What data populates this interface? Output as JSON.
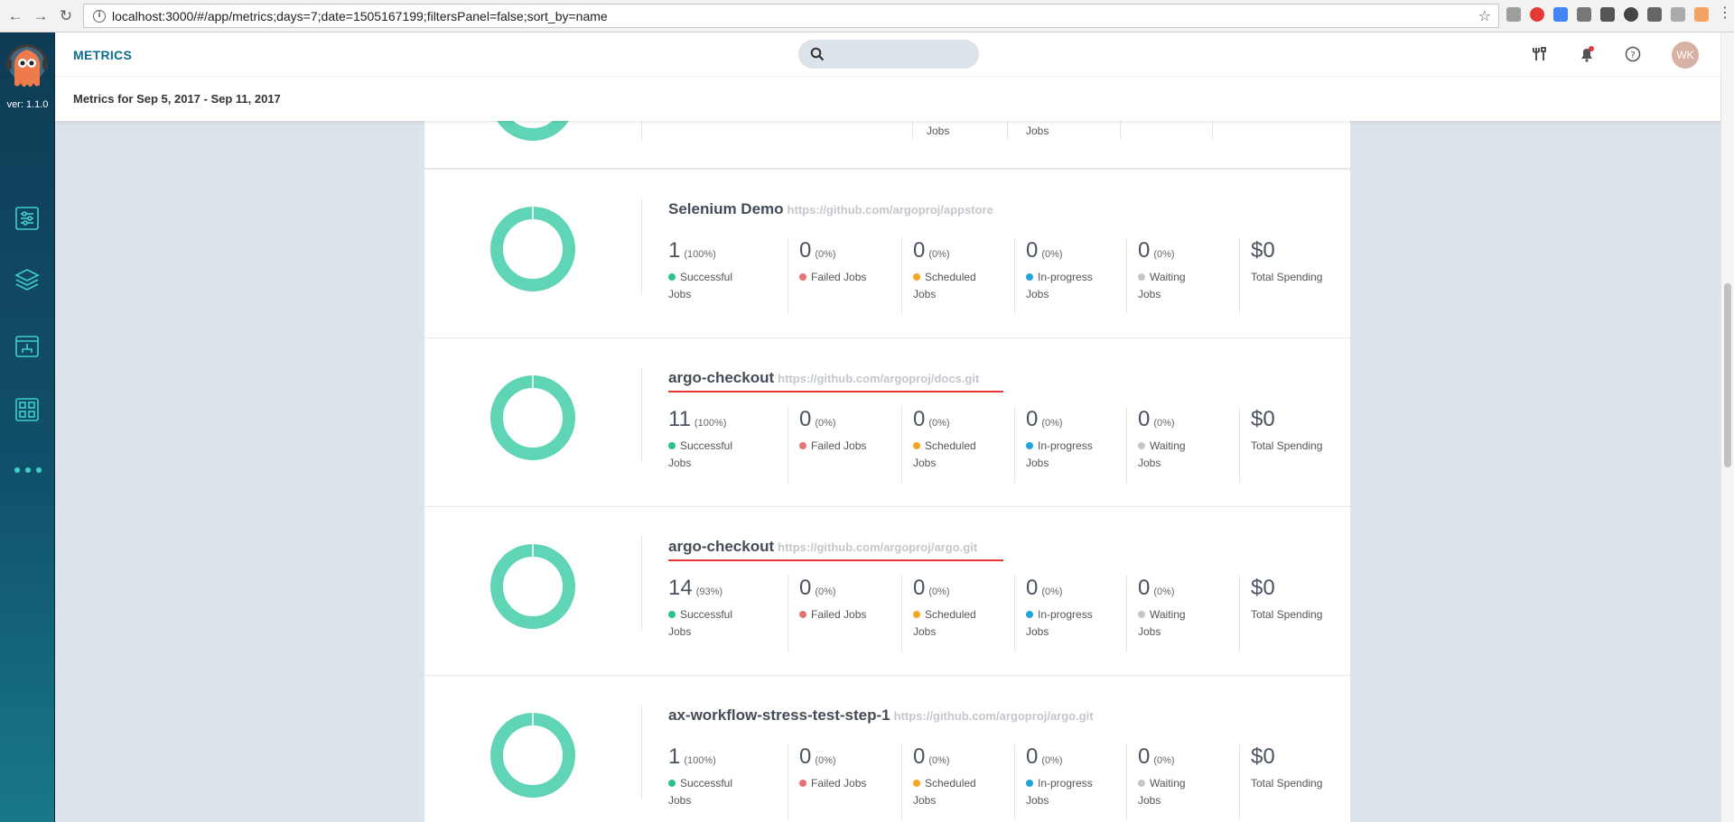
{
  "browser": {
    "url": "localhost:3000/#/app/metrics;days=7;date=1505167199;filtersPanel=false;sort_by=name"
  },
  "sidebar": {
    "version": "ver: 1.1.0"
  },
  "header": {
    "title": "METRICS",
    "search_placeholder": "",
    "avatar_initials": "WK"
  },
  "subheader": {
    "text": "Metrics for Sep 5, 2017 - Sep 11, 2017"
  },
  "colors": {
    "donut": "#5fd5b5",
    "successful": "#2fbf8f",
    "failed": "#e57373",
    "scheduled": "#f5a623",
    "inprogress": "#1fa5d9",
    "waiting": "#c4c8cc"
  },
  "partial": {
    "label_scheduled_part": "Jobs",
    "label_inprogress_part": "Jobs"
  },
  "apps": [
    {
      "name": "Selenium Demo",
      "url": "https://github.com/argoproj/appstore",
      "successful": "1",
      "successful_pct": "(100%)",
      "failed": "0",
      "failed_pct": "(0%)",
      "scheduled": "0",
      "scheduled_pct": "(0%)",
      "inprogress": "0",
      "inprogress_pct": "(0%)",
      "waiting": "0",
      "waiting_pct": "(0%)",
      "spending": "$0"
    },
    {
      "name": "argo-checkout",
      "url": "https://github.com/argoproj/docs.git",
      "successful": "11",
      "successful_pct": "(100%)",
      "failed": "0",
      "failed_pct": "(0%)",
      "scheduled": "0",
      "scheduled_pct": "(0%)",
      "inprogress": "0",
      "inprogress_pct": "(0%)",
      "waiting": "0",
      "waiting_pct": "(0%)",
      "spending": "$0"
    },
    {
      "name": "argo-checkout",
      "url": "https://github.com/argoproj/argo.git",
      "successful": "14",
      "successful_pct": "(93%)",
      "failed": "0",
      "failed_pct": "(0%)",
      "scheduled": "0",
      "scheduled_pct": "(0%)",
      "inprogress": "0",
      "inprogress_pct": "(0%)",
      "waiting": "0",
      "waiting_pct": "(0%)",
      "spending": "$0"
    },
    {
      "name": "ax-workflow-stress-test-step-1",
      "url": "https://github.com/argoproj/argo.git",
      "successful": "1",
      "successful_pct": "(100%)",
      "failed": "0",
      "failed_pct": "(0%)",
      "scheduled": "0",
      "scheduled_pct": "(0%)",
      "inprogress": "0",
      "inprogress_pct": "(0%)",
      "waiting": "0",
      "waiting_pct": "(0%)",
      "spending": "$0"
    }
  ],
  "labels": {
    "successful": "Successful Jobs",
    "failed": "Failed Jobs",
    "scheduled": "Scheduled Jobs",
    "inprogress": "In-progress Jobs",
    "waiting": "Waiting Jobs",
    "spending": "Total Spending"
  }
}
